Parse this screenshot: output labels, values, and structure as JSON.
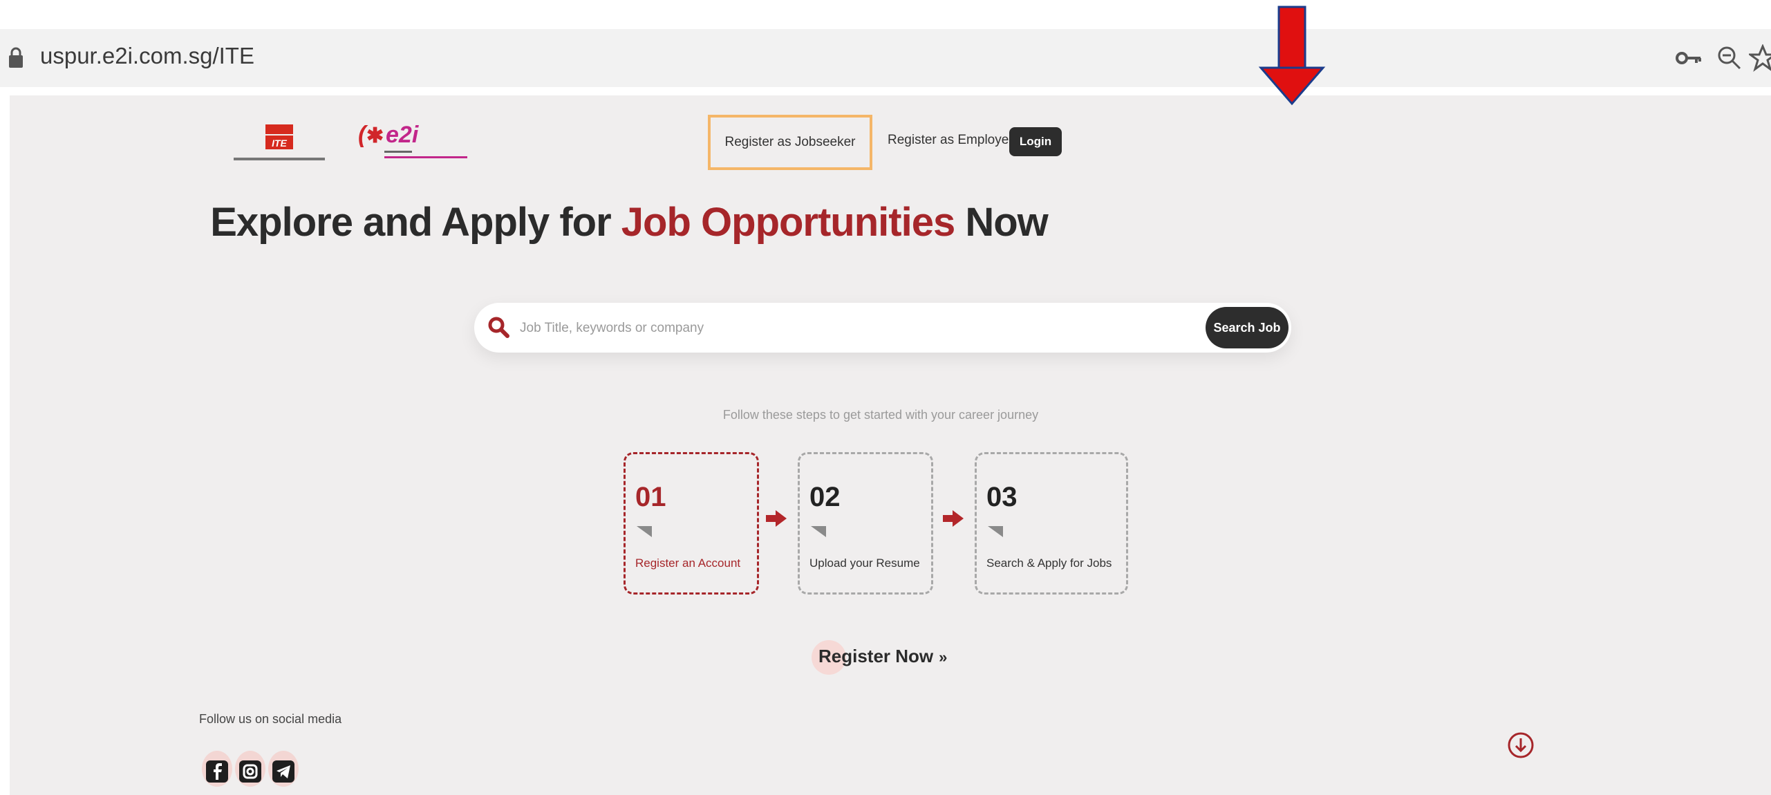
{
  "browser": {
    "url": "uspur.e2i.com.sg/ITE",
    "icons": [
      "lock-icon",
      "key-icon",
      "zoom-out-icon",
      "star-icon"
    ]
  },
  "header": {
    "logos": [
      "ite-logo",
      "e2i-logo"
    ],
    "nav": {
      "jobseeker": "Register as Jobseeker",
      "employer": "Register as Employer",
      "login": "Login"
    }
  },
  "hero": {
    "headline_pre": "Explore and Apply for ",
    "headline_accent": "Job Opportunities",
    "headline_post": " Now"
  },
  "search": {
    "placeholder": "Job Title, keywords or company",
    "button": "Search Job"
  },
  "steps": {
    "caption": "Follow these steps to get started with your career journey",
    "items": [
      {
        "num": "01",
        "label": "Register an Account"
      },
      {
        "num": "02",
        "label": "Upload your Resume"
      },
      {
        "num": "03",
        "label": "Search & Apply for Jobs"
      }
    ]
  },
  "cta": {
    "register_now": "Register Now",
    "chevrons": "»"
  },
  "footer": {
    "social_caption": "Follow us on social media",
    "social_icons": [
      "facebook-icon",
      "instagram-icon",
      "telegram-icon"
    ]
  },
  "colors": {
    "accent": "#a6262a",
    "highlight_box": "#f5b668",
    "annotation_arrow": "#e01010"
  }
}
